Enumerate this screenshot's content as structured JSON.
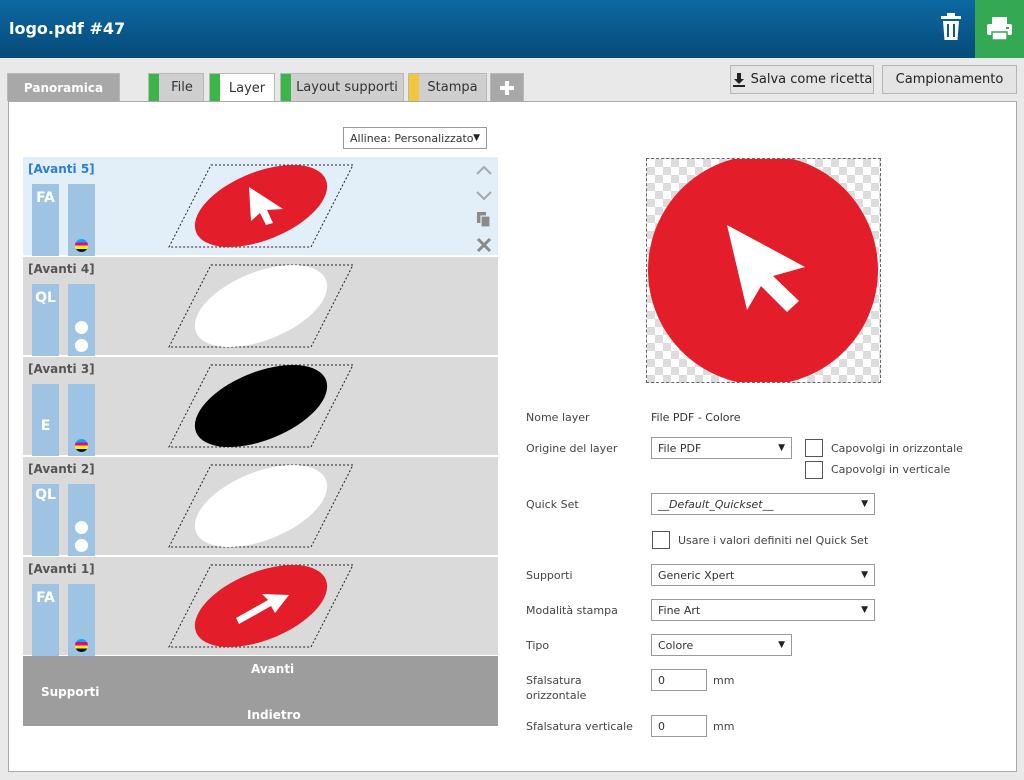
{
  "header": {
    "title": "logo.pdf #47"
  },
  "tabs": {
    "panoramica": "Panoramica",
    "file": "File",
    "layer": "Layer",
    "layout": "Layout supporti",
    "stampa": "Stampa",
    "add": "+"
  },
  "tab_colors": {
    "file": "#3bb54a",
    "layer": "#3bb54a",
    "layout": "#3bb54a",
    "stampa": "#f4c63d"
  },
  "toolbar": {
    "salva_label": "Salva come ricetta",
    "campionamento_label": "Campionamento"
  },
  "align_select": {
    "value": "Allinea: Personalizzato"
  },
  "layers": [
    {
      "name": "[Avanti 5]",
      "tag": "FA",
      "selected": true
    },
    {
      "name": "[Avanti 4]",
      "tag": "QL",
      "selected": false
    },
    {
      "name": "[Avanti 3]",
      "tag": "E",
      "selected": false
    },
    {
      "name": "[Avanti 2]",
      "tag": "QL",
      "selected": false
    },
    {
      "name": "[Avanti 1]",
      "tag": "FA",
      "selected": false
    }
  ],
  "supporti": {
    "label": "Supporti",
    "avanti": "Avanti",
    "indietro": "Indietro"
  },
  "form": {
    "nome_layer_label": "Nome layer",
    "nome_layer_value": "File PDF - Colore",
    "origine_label": "Origine del layer",
    "origine_value": "File PDF",
    "capovolgi_oriz": "Capovolgi in orizzontale",
    "capovolgi_vert": "Capovolgi in verticale",
    "quickset_label": "Quick Set",
    "quickset_value": "__Default_Quickset__",
    "usare_valori": "Usare i valori definiti nel Quick Set",
    "supporti_label": "Supporti",
    "supporti_value": "Generic Xpert",
    "modalita_label": "Modalità stampa",
    "modalita_value": "Fine Art",
    "tipo_label": "Tipo",
    "tipo_value": "Colore",
    "sfals_oriz_label_1": "Sfalsatura",
    "sfals_oriz_label_2": "orizzontale",
    "sfals_oriz_value": "0",
    "sfals_vert_label": "Sfalsatura verticale",
    "sfals_vert_value": "0",
    "unit": "mm"
  },
  "colors": {
    "brand_red": "#e31e2a",
    "selection": "#e2eef8",
    "print_green": "#35a853"
  }
}
